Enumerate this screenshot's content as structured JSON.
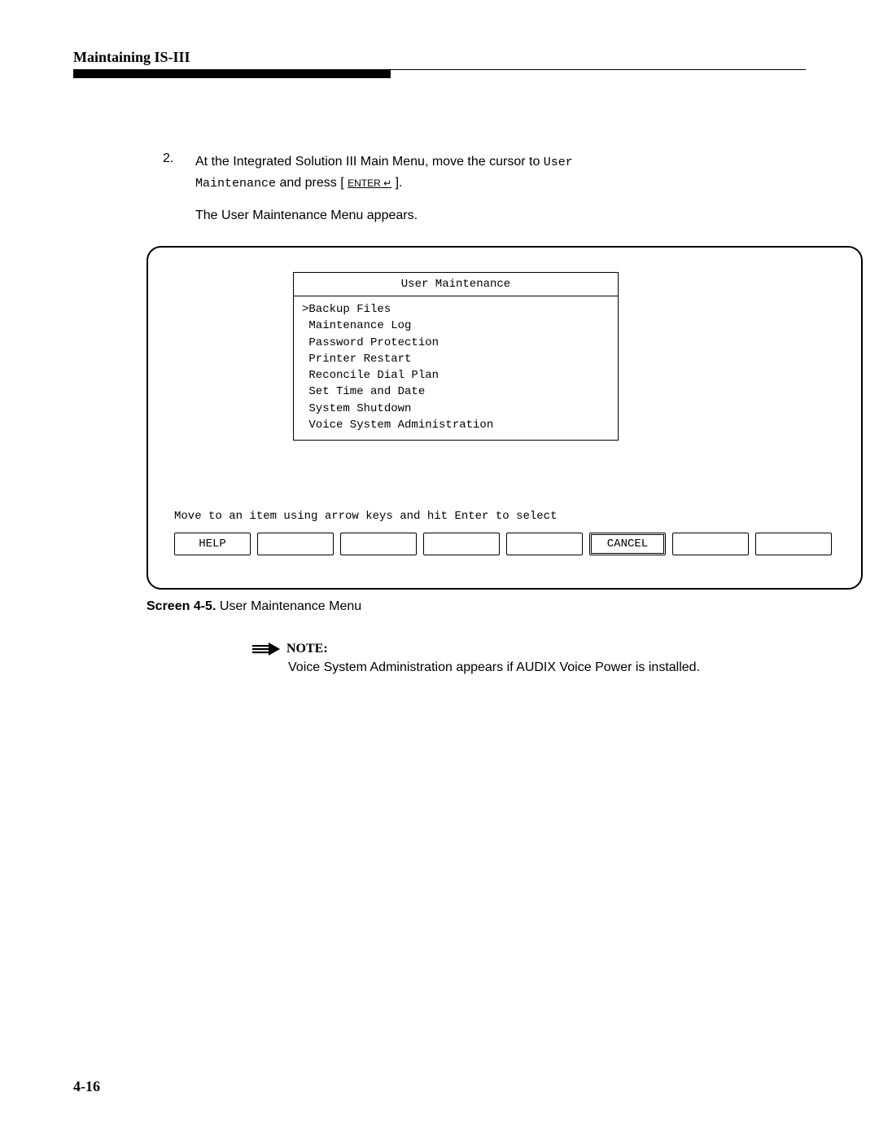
{
  "header": {
    "title": "Maintaining IS-III"
  },
  "step": {
    "number": "2.",
    "text_a": "At the Integrated Solution III Main Menu, move the cursor to ",
    "code_a": "User",
    "code_b": "Maintenance",
    "text_b": " and press [ ",
    "key": "ENTER ↵",
    "text_c": " ]."
  },
  "para_after": "The User Maintenance Menu appears.",
  "terminal": {
    "menu_title": "User Maintenance",
    "items": [
      ">Backup Files",
      " Maintenance Log",
      " Password Protection",
      " Printer Restart",
      " Reconcile Dial Plan",
      " Set Time and Date",
      " System Shutdown",
      " Voice System Administration"
    ],
    "hint": "Move to an item using arrow keys and hit Enter to select",
    "fkeys": {
      "f1": "HELP",
      "f2": "",
      "f3": "",
      "f4": "",
      "f5": "",
      "f6": "CANCEL",
      "f7": "",
      "f8": ""
    }
  },
  "caption": {
    "label": "Screen 4-5.",
    "text": " User Maintenance Menu"
  },
  "note": {
    "label": "NOTE:",
    "text": "Voice System Administration appears if AUDIX Voice Power is installed."
  },
  "page_number": "4-16"
}
